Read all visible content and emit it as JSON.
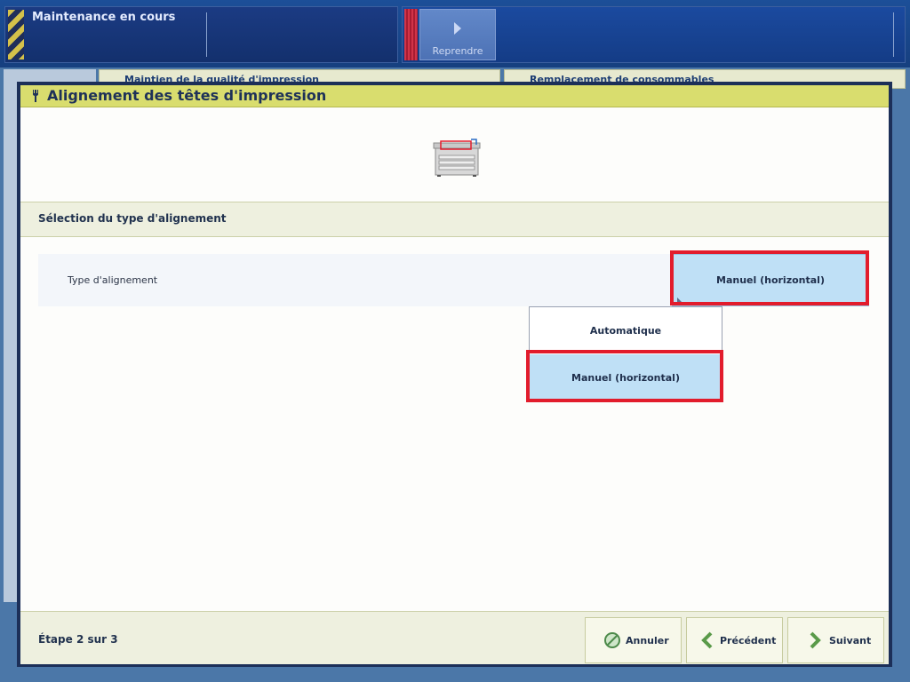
{
  "topbar": {
    "status": "Maintenance en cours",
    "resume_label": "Reprendre"
  },
  "background": {
    "tab_left": "Maintien de la qualité d'impression",
    "tab_right": "Remplacement de consommables"
  },
  "dialog": {
    "title": "Alignement des têtes d'impression",
    "section_title": "Sélection du type d'alignement",
    "setting_label": "Type d'alignement",
    "setting_value": "Manuel (horizontal)",
    "dropdown": {
      "options": [
        "Automatique",
        "Manuel (horizontal)"
      ],
      "selected": "Manuel (horizontal)"
    },
    "step": "Étape 2 sur 3",
    "buttons": {
      "cancel": "Annuler",
      "previous": "Précédent",
      "next": "Suivant"
    }
  },
  "colors": {
    "title_bar": "#d9dd6e",
    "selected_option": "#bfe0f6",
    "highlight": "#e21c2c"
  }
}
